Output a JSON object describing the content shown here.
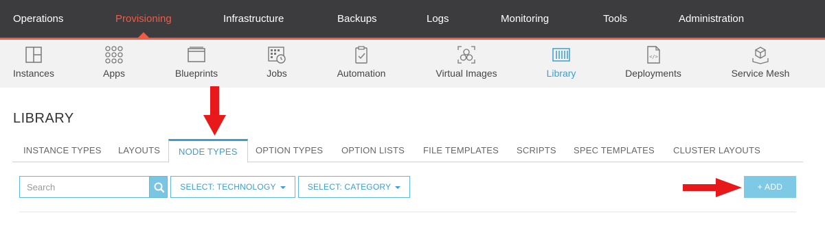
{
  "top_nav": {
    "items": [
      {
        "label": "Operations",
        "active": false
      },
      {
        "label": "Provisioning",
        "active": true
      },
      {
        "label": "Infrastructure",
        "active": false
      },
      {
        "label": "Backups",
        "active": false
      },
      {
        "label": "Logs",
        "active": false
      },
      {
        "label": "Monitoring",
        "active": false
      },
      {
        "label": "Tools",
        "active": false
      },
      {
        "label": "Administration",
        "active": false
      }
    ]
  },
  "sub_nav": {
    "items": [
      {
        "label": "Instances",
        "icon": "instances-icon"
      },
      {
        "label": "Apps",
        "icon": "apps-icon"
      },
      {
        "label": "Blueprints",
        "icon": "blueprints-icon"
      },
      {
        "label": "Jobs",
        "icon": "jobs-icon"
      },
      {
        "label": "Automation",
        "icon": "automation-icon"
      },
      {
        "label": "Virtual Images",
        "icon": "virtual-images-icon"
      },
      {
        "label": "Library",
        "icon": "library-icon",
        "active": true
      },
      {
        "label": "Deployments",
        "icon": "deployments-icon"
      },
      {
        "label": "Service Mesh",
        "icon": "service-mesh-icon"
      }
    ]
  },
  "page": {
    "title": "LIBRARY"
  },
  "tabs": [
    {
      "label": "INSTANCE TYPES"
    },
    {
      "label": "LAYOUTS"
    },
    {
      "label": "NODE TYPES",
      "active": true
    },
    {
      "label": "OPTION TYPES"
    },
    {
      "label": "OPTION LISTS"
    },
    {
      "label": "FILE TEMPLATES"
    },
    {
      "label": "SCRIPTS"
    },
    {
      "label": "SPEC TEMPLATES"
    },
    {
      "label": "CLUSTER LAYOUTS"
    }
  ],
  "toolbar": {
    "search_placeholder": "Search",
    "select_technology": "SELECT: TECHNOLOGY",
    "select_category": "SELECT: CATEGORY",
    "add_label": "+ ADD"
  },
  "colors": {
    "nav_bg": "#3c3c3e",
    "active_red": "#ef5b45",
    "accent_blue": "#3a9fcf",
    "add_button": "#7ecae6",
    "annotation_arrow": "#e8191a"
  }
}
